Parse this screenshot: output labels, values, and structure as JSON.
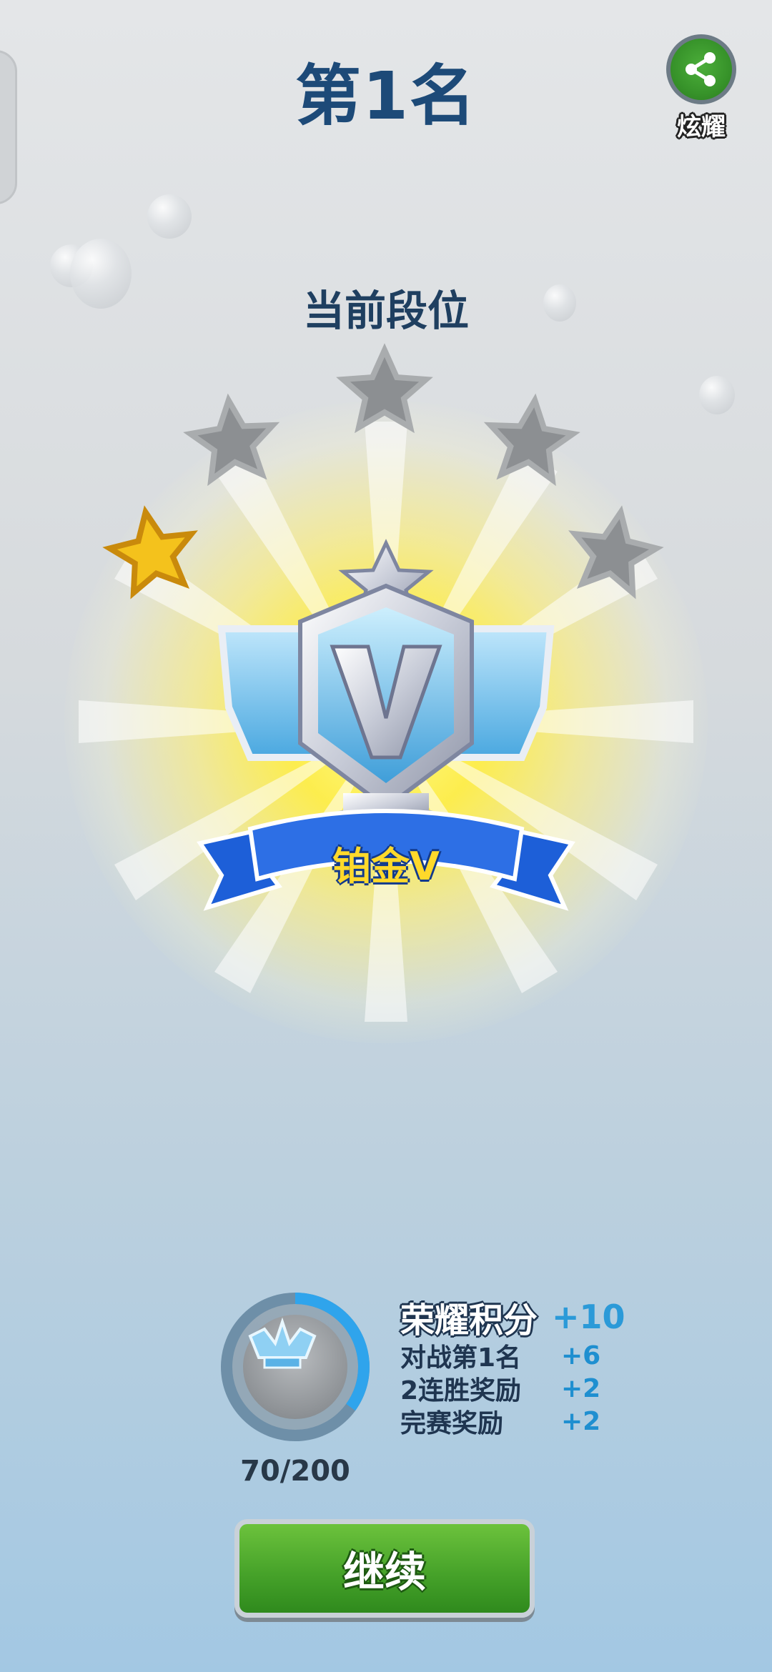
{
  "header": {
    "title": "第1名",
    "share_label": "炫耀"
  },
  "rank": {
    "section_title": "当前段位",
    "name": "铂金Ⅴ",
    "stars_total": 5,
    "stars_filled": 1
  },
  "points": {
    "progress_text": "70/200",
    "progress_fraction": 0.35,
    "main_label": "荣耀积分",
    "main_value": "+10",
    "items": [
      {
        "label": "对战第1名",
        "value": "+6"
      },
      {
        "label": "2连胜奖励",
        "value": "+2"
      },
      {
        "label": "完赛奖励",
        "value": "+2"
      }
    ]
  },
  "continue_label": "继续",
  "colors": {
    "accent_green": "#47a32a",
    "title_blue": "#1d4a78",
    "star_gold": "#f5c11b",
    "star_grey": "#8a8d90"
  }
}
